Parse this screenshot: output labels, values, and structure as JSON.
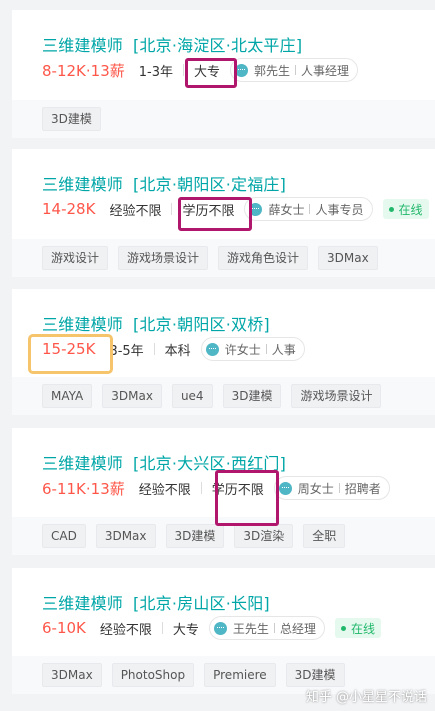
{
  "jobs": [
    {
      "title": "三维建模师",
      "location": "[北京·海淀区·北太平庄]",
      "salary": "8-12K·13薪",
      "experience": "1-3年",
      "education": "大专",
      "recruiter_name": "郭先生",
      "recruiter_role": "人事经理",
      "online": "",
      "tags": [
        "3D建模"
      ]
    },
    {
      "title": "三维建模师",
      "location": "[北京·朝阳区·定福庄]",
      "salary": "14-28K",
      "experience": "经验不限",
      "education": "学历不限",
      "recruiter_name": "薛女士",
      "recruiter_role": "人事专员",
      "online": "在线",
      "tags": [
        "游戏设计",
        "游戏场景设计",
        "游戏角色设计",
        "3DMax"
      ]
    },
    {
      "title": "三维建模师",
      "location": "[北京·朝阳区·双桥]",
      "salary": "15-25K",
      "experience": "3-5年",
      "education": "本科",
      "recruiter_name": "许女士",
      "recruiter_role": "人事",
      "online": "",
      "tags": [
        "MAYA",
        "3DMax",
        "ue4",
        "3D建模",
        "游戏场景设计"
      ]
    },
    {
      "title": "三维建模师",
      "location": "[北京·大兴区·西红门]",
      "salary": "6-11K·13薪",
      "experience": "经验不限",
      "education": "学历不限",
      "recruiter_name": "周女士",
      "recruiter_role": "招聘者",
      "online": "",
      "tags": [
        "CAD",
        "3DMax",
        "3D建模",
        "3D渲染",
        "全职"
      ]
    },
    {
      "title": "三维建模师",
      "location": "[北京·房山区·长阳]",
      "salary": "6-10K",
      "experience": "经验不限",
      "education": "大专",
      "recruiter_name": "王先生",
      "recruiter_role": "总经理",
      "online": "在线",
      "tags": [
        "3DMax",
        "PhotoShop",
        "Premiere",
        "3D建模"
      ]
    }
  ],
  "watermark": "知乎 @小星星不说话",
  "colors": {
    "title": "#00a6a7",
    "salary": "#fe574a",
    "annotation_magenta": "#b0176c",
    "annotation_orange": "#f5c46b",
    "online": "#22b86b"
  },
  "icons": {
    "recruiter": "chat-bubble-icon"
  }
}
